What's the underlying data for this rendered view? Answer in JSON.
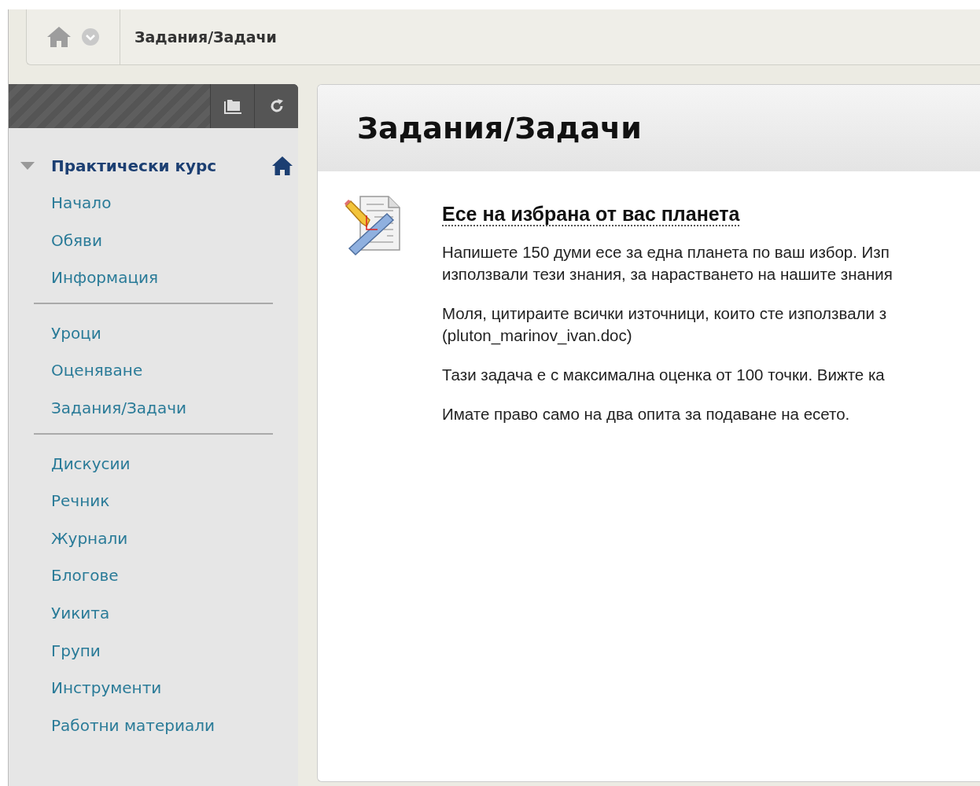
{
  "breadcrumb": {
    "title": "Задания/Задачи"
  },
  "sidebar": {
    "course": {
      "title": "Практически курс",
      "expanded": true
    },
    "groups": [
      {
        "items": [
          "Начало",
          "Обяви",
          "Информация"
        ]
      },
      {
        "items": [
          "Уроци",
          "Оценяване",
          "Задания/Задачи"
        ]
      },
      {
        "items": [
          "Дискусии",
          "Речник",
          "Журнали",
          "Блогове",
          "Уикита",
          "Групи",
          "Инструменти",
          "Работни материали"
        ]
      }
    ]
  },
  "page": {
    "title": "Задания/Задачи",
    "assignment": {
      "title": "Есе на избрана от вас планета",
      "paragraphs": [
        [
          "Напишете 150 думи есе за една планета по ваш избор. Изп",
          "използвали тези знания, за нарастването на нашите знания"
        ],
        [
          "Моля, цитираите всички източници, които сте използвали з",
          "(pluton_marinov_ivan.doc)"
        ],
        [
          "Тази задача е с максимална оценка от 100 точки. Вижте ка"
        ],
        [
          "Имате право само на два опита за подаване на есето."
        ]
      ]
    }
  }
}
